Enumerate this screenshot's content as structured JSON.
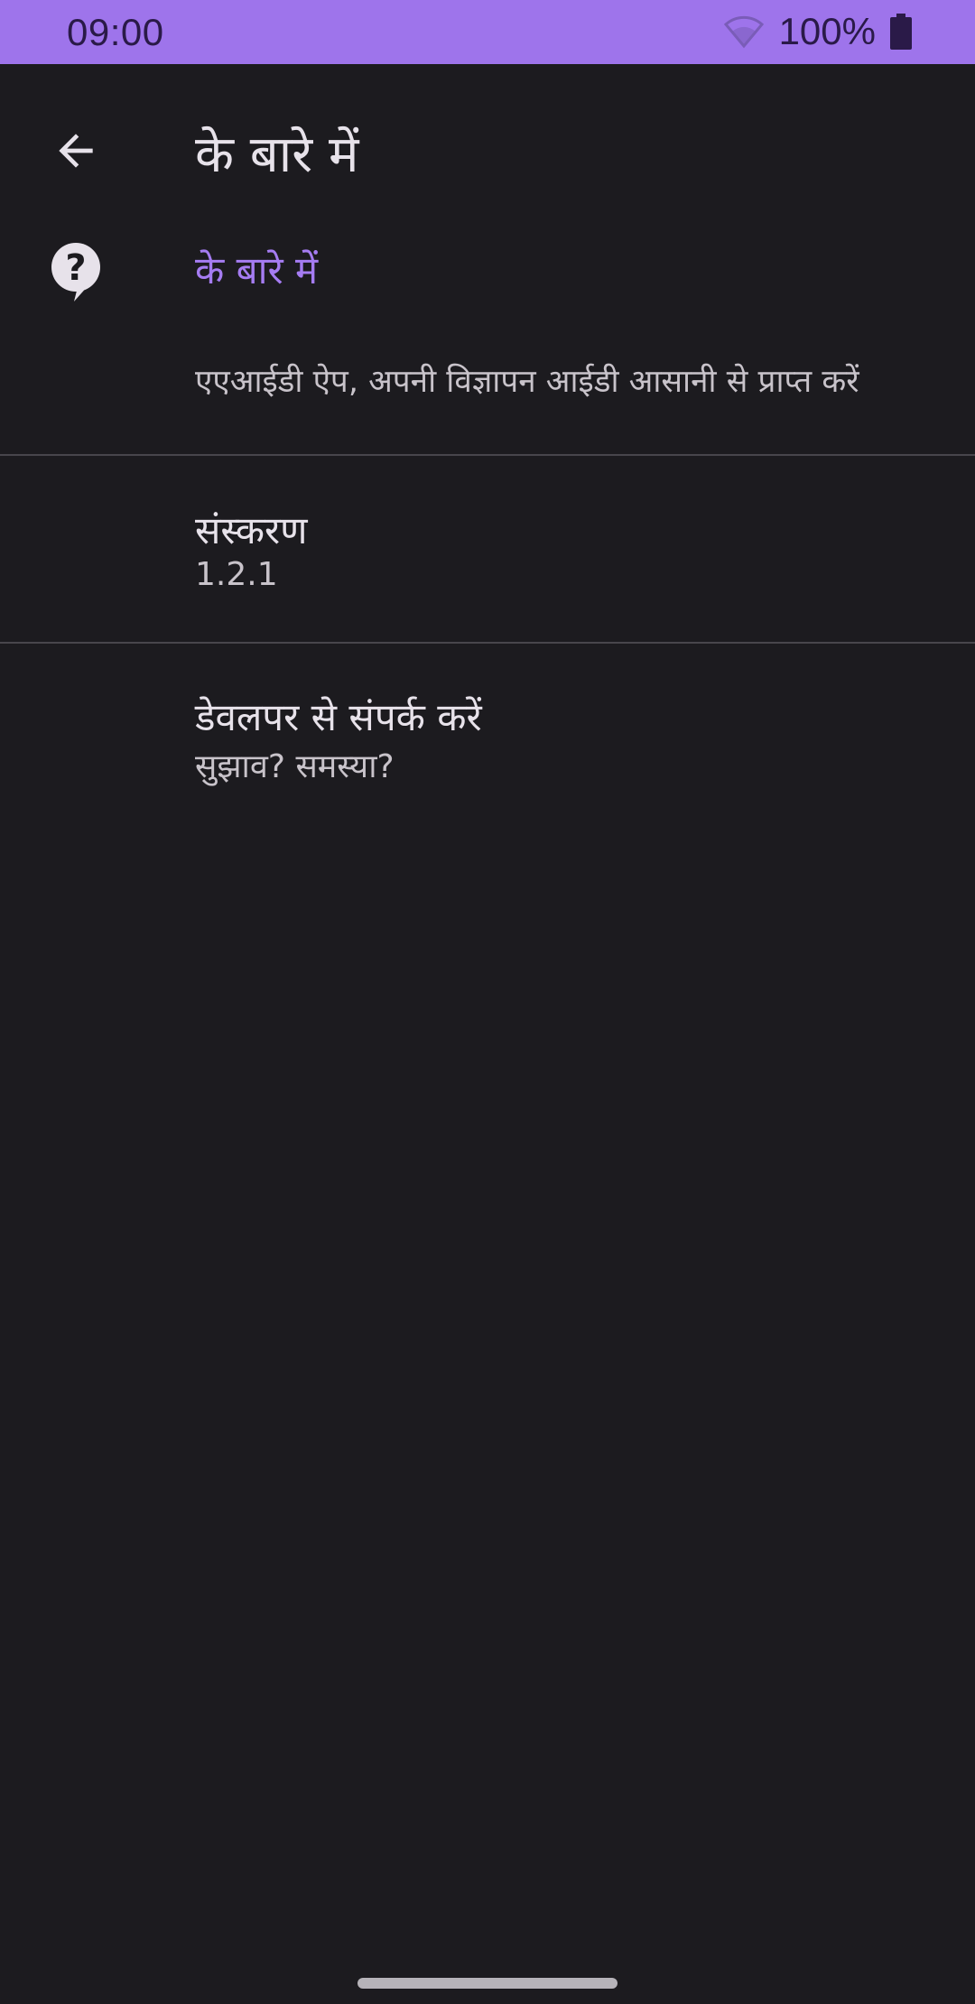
{
  "status_bar": {
    "time": "09:00",
    "battery_percent": "100%",
    "background_color": "#9e74eb",
    "icons": [
      "wifi-icon",
      "battery-icon"
    ]
  },
  "app_bar": {
    "back_icon": "arrow-back-icon",
    "title": "के बारे में"
  },
  "about_section": {
    "icon": "help-bubble-icon",
    "title": "के बारे में",
    "title_color": "#a57cf2",
    "description": "एएआईडी ऐप, अपनी विज्ञापन आईडी आसानी से प्राप्त करें"
  },
  "preferences": [
    {
      "title": "संस्करण",
      "summary": "1.2.1"
    },
    {
      "title": "डेवलपर से संपर्क करें",
      "summary": "सुझाव? समस्या?"
    }
  ]
}
